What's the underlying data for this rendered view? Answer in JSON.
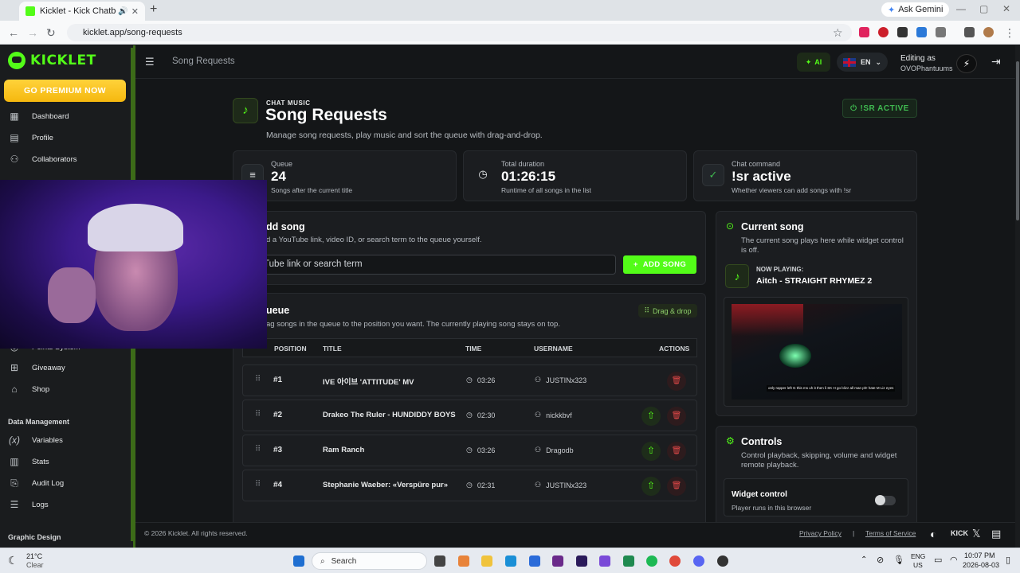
{
  "browser": {
    "tab_title": "Kicklet - Kick Chatbot, Kick",
    "url": "kicklet.app/song-requests",
    "gemini_label": "Ask Gemini"
  },
  "sidebar": {
    "logo": "KICKLET",
    "premium_label": "GO PREMIUM NOW",
    "items_top": [
      {
        "label": "Dashboard",
        "icon": "grid-icon"
      },
      {
        "label": "Profile",
        "icon": "id-card-icon"
      },
      {
        "label": "Collaborators",
        "icon": "users-icon"
      }
    ],
    "items_mid": [
      {
        "label": "Points System",
        "icon": "coin-icon"
      },
      {
        "label": "Giveaway",
        "icon": "gift-icon"
      },
      {
        "label": "Shop",
        "icon": "shop-icon"
      }
    ],
    "section_data": "Data Management",
    "items_data": [
      {
        "label": "Variables",
        "icon": "function-icon"
      },
      {
        "label": "Stats",
        "icon": "chart-icon"
      },
      {
        "label": "Audit Log",
        "icon": "audit-icon"
      },
      {
        "label": "Logs",
        "icon": "logs-icon"
      }
    ],
    "section_graphic": "Graphic Design"
  },
  "topbar": {
    "breadcrumb": "Song Requests",
    "ai_label": "AI",
    "lang_label": "EN",
    "editing_label": "Editing as",
    "editing_user": "OVOPhantuums"
  },
  "hero": {
    "kicker": "CHAT MUSIC",
    "title": "Song Requests",
    "subtitle": "Manage song requests, play music and sort the queue with drag-and-drop.",
    "active_badge": "!SR ACTIVE"
  },
  "stats": [
    {
      "label": "Queue",
      "value": "24",
      "desc": "Songs after the current title",
      "icon": "queue-icon"
    },
    {
      "label": "Total duration",
      "value": "01:26:15",
      "desc": "Runtime of all songs in the list",
      "icon": "clock-icon"
    },
    {
      "label": "Chat command",
      "value": "!sr active",
      "desc": "Whether viewers can add songs with !sr",
      "icon": "check-icon"
    }
  ],
  "add_song": {
    "title": "dd song",
    "subtitle": "d a YouTube link, video ID, or search term to the queue yourself.",
    "placeholder": "Tube link or search term",
    "button": "ADD SONG"
  },
  "queue": {
    "title": "ueue",
    "subtitle": "ag songs in the queue to the position you want. The currently playing song stays on top.",
    "badge": "Drag & drop",
    "headers": {
      "position": "POSITION",
      "title": "TITLE",
      "time": "TIME",
      "username": "USERNAME",
      "actions": "ACTIONS"
    },
    "rows": [
      {
        "pos": "#1",
        "title": "IVE 아이브 'ATTITUDE' MV",
        "time": "03:26",
        "user": "JUSTINx323",
        "can_move": false
      },
      {
        "pos": "#2",
        "title": "Drakeo The Ruler - HUNDIDDY BOYS",
        "time": "02:30",
        "user": "nickkbvf",
        "can_move": true
      },
      {
        "pos": "#3",
        "title": "Ram Ranch",
        "time": "03:26",
        "user": "Dragodb",
        "can_move": true
      },
      {
        "pos": "#4",
        "title": "Stephanie Waeber: «Verspüre pur»",
        "time": "02:31",
        "user": "JUSTINx323",
        "can_move": true
      }
    ]
  },
  "current_song": {
    "title": "Current song",
    "subtitle": "The current song plays here while widget control is off.",
    "now_playing_label": "NOW PLAYING:",
    "song": "Aitch - STRAIGHT RHYMEZ 2",
    "caption": "only rapper left G this ms uh it then li SK H go blizz all man ph! hate M Liz eyes"
  },
  "controls": {
    "title": "Controls",
    "subtitle": "Control playback, skipping, volume and widget remote playback.",
    "widget_title": "Widget control",
    "widget_desc": "Player runs in this browser",
    "widget_on": false
  },
  "footer": {
    "copyright": "© 2026 Kicklet. All rights reserved.",
    "privacy": "Privacy Policy",
    "terms": "Terms of Service",
    "kick": "KICK"
  },
  "taskbar": {
    "weather_temp": "21°C",
    "weather_desc": "Clear",
    "search": "Search",
    "lang": "ENG",
    "region": "US",
    "time": "10:07 PM",
    "date": "2026-08-03"
  }
}
